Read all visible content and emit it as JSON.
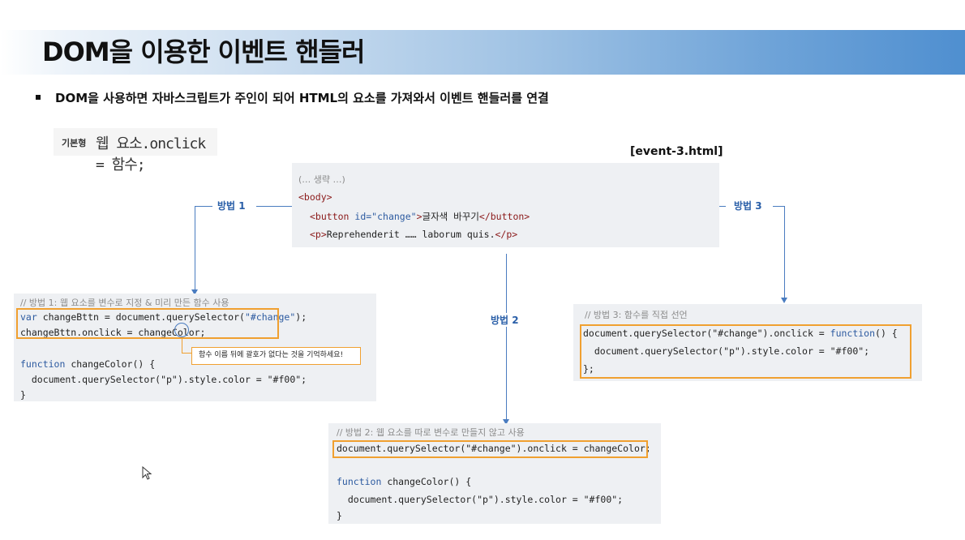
{
  "title": "DOM을 이용한 이벤트 핸들러",
  "bullet": "DOM을 사용하면 자바스크립트가 주인이 되어 HTML의 요소를 가져와서 이벤트 핸들러를 연결",
  "basic_form": {
    "tag": "기본형",
    "code": "웹 요소.onclick = 함수;"
  },
  "file_label": "[event-3.html]",
  "html_code": {
    "line1": "(… 생략 …)",
    "line2": "<body>",
    "line3_tag": "<button",
    "line3_attr": " id=",
    "line3_val": "\"change\"",
    "line3_close": ">",
    "line3_text": "글자색 바꾸기",
    "line3_end": "</button>",
    "line4_tag": "<p>",
    "line4_text": "Reprehenderit …… laborum quis.",
    "line4_end": "</p>"
  },
  "methods": {
    "m1": "방법 1",
    "m2": "방법 2",
    "m3": "방법 3"
  },
  "method1": {
    "comment": "// 방법 1: 웹 요소를 변수로 지정 & 미리 만든 함수 사용",
    "l1_kw": "var",
    "l1_rest": " changeBttn = document.querySelector(",
    "l1_str": "\"#change\"",
    "l1_end": ");",
    "l2": "changeBttn.onclick = changeColor;",
    "l3_kw": "function",
    "l3_rest": " changeColor() {",
    "l4": "  document.querySelector(\"p\").style.color = \"#f00\";",
    "l5": "}",
    "note": "함수 이름 뒤에 괄호가 없다는 것을 기억하세요!"
  },
  "method2": {
    "comment": "// 방법 2: 웹 요소를 따로 변수로 만들지 않고 사용",
    "l1": "document.querySelector(\"#change\").onclick = changeColor;",
    "l2_kw": "function",
    "l2_rest": " changeColor() {",
    "l3": "  document.querySelector(\"p\").style.color = \"#f00\";",
    "l4": "}"
  },
  "method3": {
    "comment": "// 방법 3: 함수를 직접 선언",
    "l1_a": "document.querySelector(\"#change\").onclick = ",
    "l1_kw": "function",
    "l1_b": "() {",
    "l2": "  document.querySelector(\"p\").style.color = \"#f00\";",
    "l3": "};"
  }
}
